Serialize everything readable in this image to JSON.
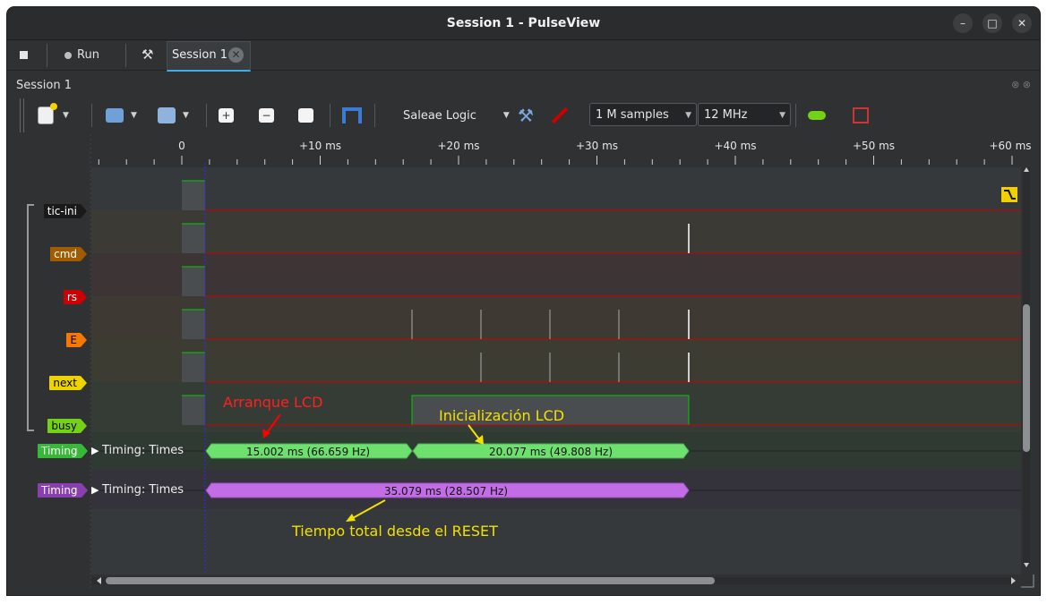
{
  "window": {
    "title": "Session 1 - PulseView"
  },
  "tabbar": {
    "run_label": "Run",
    "session_tab_label": "Session 1"
  },
  "dock": {
    "title": "Session 1"
  },
  "toolbar": {
    "device": "Saleae Logic",
    "samples": "1 M samples",
    "samplerate": "12 MHz"
  },
  "ruler": {
    "ticks": [
      "0",
      "+10 ms",
      "+20 ms",
      "+30 ms",
      "+40 ms",
      "+50 ms",
      "+60 ms"
    ]
  },
  "channels": [
    {
      "name": "tic-ini",
      "color": "#1a1a1a",
      "text": "#ffffff"
    },
    {
      "name": "cmd",
      "color": "#a35b00",
      "text": "#ffffff"
    },
    {
      "name": "rs",
      "color": "#cc0000",
      "text": "#ffffff"
    },
    {
      "name": "E",
      "color": "#f57900",
      "text": "#000000"
    },
    {
      "name": "next",
      "color": "#edd400",
      "text": "#000000"
    },
    {
      "name": "busy",
      "color": "#73d216",
      "text": "#000000"
    }
  ],
  "decoders": [
    {
      "tag": "Timing",
      "row_label": "Timing: Times",
      "color": "#4ba84b",
      "segments": [
        "15.002 ms (66.659 Hz)",
        "20.077 ms (49.808 Hz)"
      ]
    },
    {
      "tag": "Timing",
      "row_label": "Timing: Times",
      "color": "#8a3fb0",
      "segments": [
        "35.079 ms (28.507 Hz)"
      ]
    }
  ],
  "annotations": {
    "arranque": "Arranque LCD",
    "inicializacion": "Inicialización LCD",
    "total": "Tiempo total desde el RESET"
  }
}
